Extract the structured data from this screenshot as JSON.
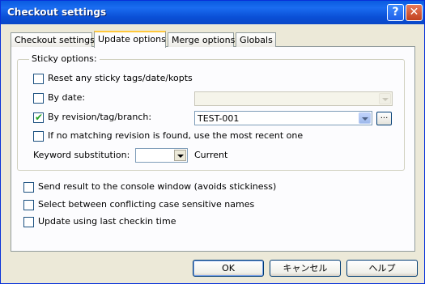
{
  "window": {
    "title": "Checkout settings",
    "help_glyph": "?",
    "close_glyph": "✕"
  },
  "tabs": [
    {
      "label": "Checkout settings",
      "active": false
    },
    {
      "label": "Update options",
      "active": true
    },
    {
      "label": "Merge options",
      "active": false
    },
    {
      "label": "Globals",
      "active": false
    }
  ],
  "sticky": {
    "legend": "Sticky options:",
    "reset": {
      "label": "Reset any sticky tags/date/kopts",
      "checked": false
    },
    "by_date": {
      "label": "By date:",
      "checked": false,
      "value": ""
    },
    "by_rev": {
      "label": "By revision/tag/branch:",
      "checked": true,
      "value": "TEST-001",
      "browse": "..."
    },
    "no_match": {
      "label": "If no matching revision is found, use the most recent one",
      "checked": false
    },
    "keyword": {
      "label": "Keyword substitution:",
      "value": "",
      "current": "Current"
    }
  },
  "options": [
    {
      "label": "Send result to the console window (avoids stickiness)",
      "checked": false
    },
    {
      "label": "Select between conflicting case sensitive names",
      "checked": false
    },
    {
      "label": "Update using last checkin time",
      "checked": false
    }
  ],
  "buttons": {
    "ok": "OK",
    "cancel": "キャンセル",
    "help": "ヘルプ"
  },
  "colors": {
    "titlebar": "#0A5BE0",
    "dialog_bg": "#ECE9D8",
    "check_mark": "#21A121",
    "active_tab_accent": "#FFC83C"
  }
}
